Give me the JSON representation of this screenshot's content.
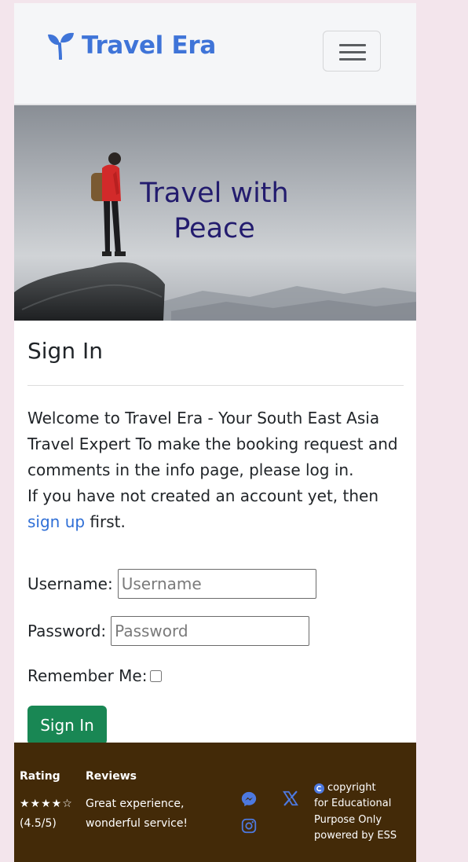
{
  "navbar": {
    "brand": "Travel Era",
    "toggler_label": "Toggle navigation"
  },
  "hero": {
    "title": "Travel with Peace"
  },
  "main": {
    "heading": "Sign In",
    "intro_line1": "Welcome to Travel Era - Your South East Asia Travel Expert To make the booking request and comments in the info page, please log in.",
    "intro_line2_before": "If you have not created an account yet, then ",
    "signup_link": "sign up",
    "intro_line2_after": " first."
  },
  "form": {
    "username_label": "Username:",
    "username_placeholder": "Username",
    "username_value": "",
    "password_label": "Password:",
    "password_placeholder": "Password",
    "password_value": "",
    "remember_label": "Remember Me:",
    "remember_checked": false,
    "submit_label": "Sign In"
  },
  "footer": {
    "rating_heading": "Rating",
    "rating_stars": "★★★★☆",
    "rating_value": "(4.5/5)",
    "reviews_heading": "Reviews",
    "review_line1": "Great experience,",
    "review_line2": "wonderful service!",
    "copyright_line1": "copyright",
    "copyright_line2": "for Educational",
    "copyright_line3": "Purpose Only",
    "copyright_line4": "powered by ESS",
    "social_icons": [
      "messenger-icon",
      "x-icon",
      "instagram-icon"
    ]
  },
  "colors": {
    "brand": "#3f74d8",
    "hero_title": "#231c6e",
    "link": "#2f6fd6",
    "button": "#198754",
    "footer_bg": "#432a08",
    "page_bg": "#f3e5ec"
  }
}
